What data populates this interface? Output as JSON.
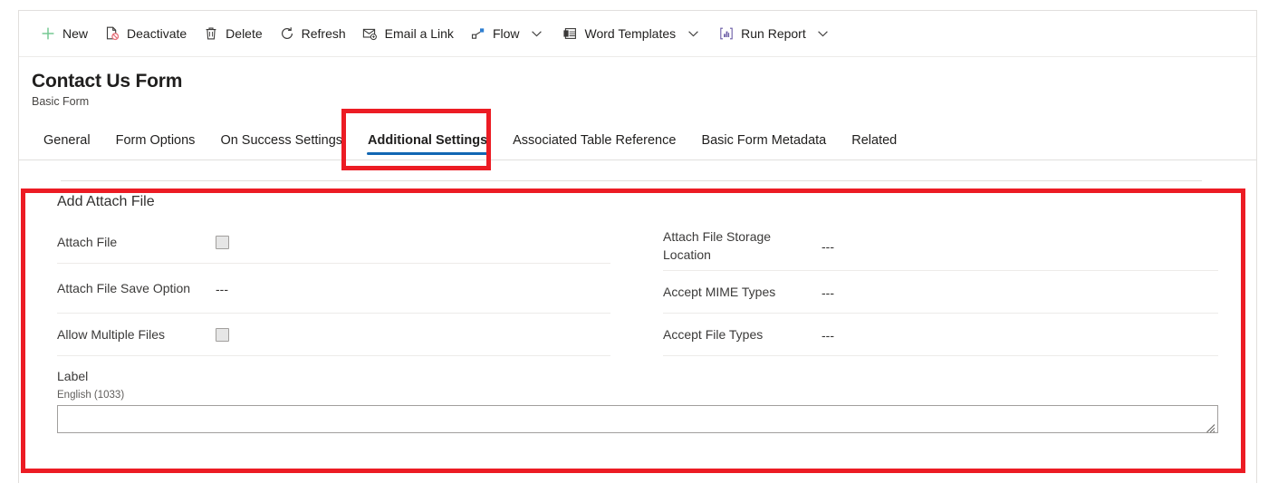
{
  "command_bar": {
    "items": [
      {
        "label": "New",
        "icon": "plus-icon",
        "caret": false
      },
      {
        "label": "Deactivate",
        "icon": "deactivate-icon",
        "caret": false
      },
      {
        "label": "Delete",
        "icon": "trash-icon",
        "caret": false
      },
      {
        "label": "Refresh",
        "icon": "refresh-icon",
        "caret": false
      },
      {
        "label": "Email a Link",
        "icon": "email-link-icon",
        "caret": false
      },
      {
        "label": "Flow",
        "icon": "flow-icon",
        "caret": true
      },
      {
        "label": "Word Templates",
        "icon": "word-template-icon",
        "caret": true
      },
      {
        "label": "Run Report",
        "icon": "run-report-icon",
        "caret": true
      }
    ]
  },
  "header": {
    "title": "Contact Us Form",
    "subtitle": "Basic Form"
  },
  "tabs": [
    {
      "label": "General",
      "active": false
    },
    {
      "label": "Form Options",
      "active": false
    },
    {
      "label": "On Success Settings",
      "active": false
    },
    {
      "label": "Additional Settings",
      "active": true
    },
    {
      "label": "Associated Table Reference",
      "active": false
    },
    {
      "label": "Basic Form Metadata",
      "active": false
    },
    {
      "label": "Related",
      "active": false
    }
  ],
  "section": {
    "title": "Add Attach File",
    "left_fields": [
      {
        "label": "Attach File",
        "value": "",
        "control": "checkbox"
      },
      {
        "label": "Attach File Save Option",
        "value": "---",
        "control": "text"
      },
      {
        "label": "Allow Multiple Files",
        "value": "",
        "control": "checkbox"
      }
    ],
    "right_fields": [
      {
        "label": "Attach File Storage Location",
        "value": "---",
        "control": "text"
      },
      {
        "label": "Accept MIME Types",
        "value": "---",
        "control": "text"
      },
      {
        "label": "Accept File Types",
        "value": "---",
        "control": "text"
      }
    ],
    "label_block": {
      "caption": "Label",
      "language": "English (1033)",
      "value": "",
      "placeholder": ""
    }
  },
  "annotations": {
    "accent_color": "#ec1c24",
    "active_tab_underline_color": "#1267b3"
  }
}
